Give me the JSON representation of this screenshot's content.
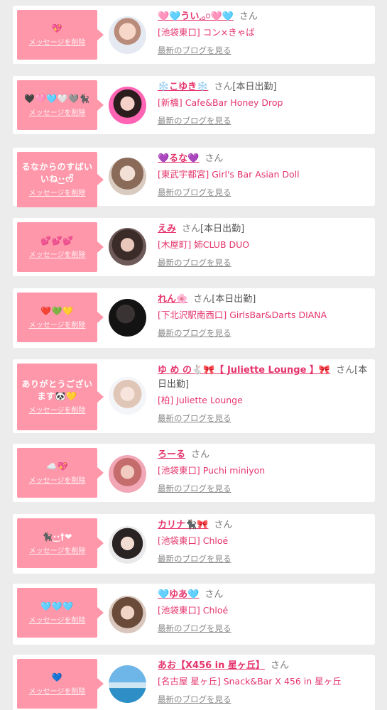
{
  "delete_label": "メッセージを削除",
  "blog_label": "最新のブログを見る",
  "san_label": "さん",
  "colors": {
    "accent": "#e5336b",
    "bubble": "#ff97aa",
    "background": "#ececec"
  },
  "cards": [
    {
      "message": "💖",
      "name": "🩷🩵うい𓈒𓂂𓏸🩷🩵",
      "status": "",
      "shop": "[池袋東口] コン×きゃば",
      "avatar": "avatar-girl-white-hat"
    },
    {
      "message": "🖤🩷🩵🤍🩶🐈‍⬛",
      "name": "❄️こゆき❄️",
      "status": "[本日出勤]",
      "shop": "[新橋] Cafe&Bar Honey Drop",
      "avatar": "avatar-girl-pink-frame"
    },
    {
      "message": "るなからのすばいいね·͜·ᰔᩚ",
      "name": "💜るな💜",
      "status": "",
      "shop": "[東武宇都宮] Girl's Bar Asian Doll",
      "avatar": "avatar-girl-brown-hair"
    },
    {
      "message": "💕💕💕",
      "name": "えみ",
      "status": "[本日出勤]",
      "shop": "[木屋町] 姉CLUB DUO",
      "avatar": "avatar-girl-dark-hair"
    },
    {
      "message": "❤️💚💛",
      "name": "れん🌸",
      "status": "[本日出勤]",
      "shop": "[下北沢駅南西口] GirlsBar&Darts DIANA",
      "avatar": "avatar-girl-mirror"
    },
    {
      "message": "ありがとうございます🐼💛",
      "name": "ゆ め の🐇🎀【 Juliette Lounge 】🎀",
      "status": "[本日出勤]",
      "shop": "[柏] Juliette Lounge",
      "avatar": "avatar-girl-light"
    },
    {
      "message": "☁️💖",
      "name": "ろーる",
      "status": "",
      "shop": "[池袋東口] Puchi miniyon",
      "avatar": "avatar-girl-pink-bg"
    },
    {
      "message": "🐈‍⬛·͜·†❤",
      "name": "カリナ🐈‍⬛🎀",
      "status": "",
      "shop": "[池袋東口] Chloé",
      "avatar": "avatar-girl-animal-ears"
    },
    {
      "message": "🩵🩵🩵",
      "name": "🩵ゆあ🩵",
      "status": "",
      "shop": "[池袋東口] Chloé",
      "avatar": "avatar-girl-long-hair"
    },
    {
      "message": "💙",
      "name": "あお【X456 in 星ヶ丘】",
      "status": "",
      "shop": "[名古屋 星ヶ丘] Snack&Bar X 456 in 星ヶ丘",
      "avatar": "avatar-sky-ocean"
    }
  ]
}
